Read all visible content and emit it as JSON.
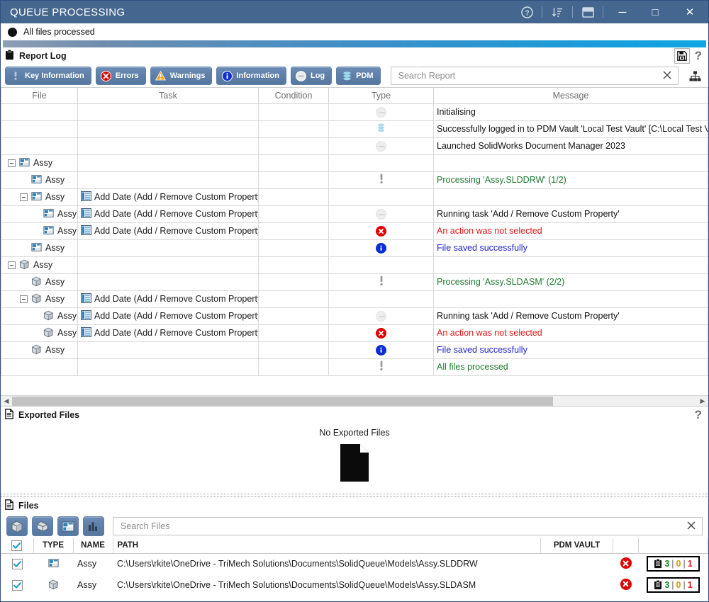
{
  "window": {
    "title": "QUEUE PROCESSING",
    "titlebar_icons": [
      "help-icon",
      "sort-descending-icon",
      "window-layout-icon"
    ],
    "controls": {
      "minimize": "─",
      "maximize": "□",
      "close": "✕"
    }
  },
  "status": {
    "text": "All files processed",
    "progress_percent": 100
  },
  "report_log": {
    "title": "Report Log",
    "save_icon": "floppy-disk-icon",
    "help_icon": "question-mark-icon",
    "filters": [
      {
        "label": "Key Information",
        "icon": "exclamation-icon"
      },
      {
        "label": "Errors",
        "icon": "error-circle-icon"
      },
      {
        "label": "Warnings",
        "icon": "warning-triangle-icon"
      },
      {
        "label": "Information",
        "icon": "info-circle-icon"
      },
      {
        "label": "Log",
        "icon": "log-circle-icon"
      },
      {
        "label": "PDM",
        "icon": "database-icon"
      }
    ],
    "search": {
      "placeholder": "Search Report",
      "value": "",
      "clear_icon": "close-x-icon"
    },
    "tree_view_icon": "hierarchy-icon",
    "columns": [
      "File",
      "Task",
      "Condition",
      "Type",
      "Message"
    ],
    "rows": [
      {
        "indent": 0,
        "expander": false,
        "file": "",
        "file_icon": "",
        "task": "",
        "condition": "",
        "type": "log",
        "message": "Initialising",
        "color": "black"
      },
      {
        "indent": 0,
        "expander": false,
        "file": "",
        "file_icon": "",
        "task": "",
        "condition": "",
        "type": "pdm",
        "message": "Successfully logged in to PDM Vault 'Local Test Vault' [C:\\Local Test Vaul",
        "color": "black"
      },
      {
        "indent": 0,
        "expander": false,
        "file": "",
        "file_icon": "",
        "task": "",
        "condition": "",
        "type": "log",
        "message": "Launched SolidWorks Document Manager 2023",
        "color": "black"
      },
      {
        "indent": 0,
        "expander": true,
        "file": "Assy",
        "file_icon": "drawing-icon",
        "task": "",
        "condition": "",
        "type": "",
        "message": "",
        "color": "black"
      },
      {
        "indent": 1,
        "expander": false,
        "file": "Assy",
        "file_icon": "drawing-icon",
        "task": "",
        "condition": "",
        "type": "key",
        "message": "Processing 'Assy.SLDDRW' (1/2)",
        "color": "green"
      },
      {
        "indent": 1,
        "expander": true,
        "file": "Assy",
        "file_icon": "drawing-icon",
        "task": "Add Date (Add / Remove Custom Property)",
        "task_icon": "property-list-icon",
        "condition": "",
        "type": "",
        "message": "",
        "color": "black"
      },
      {
        "indent": 2,
        "expander": false,
        "file": "Assy",
        "file_icon": "drawing-icon",
        "task": "Add Date (Add / Remove Custom Property)",
        "task_icon": "property-list-icon",
        "condition": "",
        "type": "log",
        "message": "Running task 'Add / Remove Custom Property'",
        "color": "black"
      },
      {
        "indent": 2,
        "expander": false,
        "file": "Assy",
        "file_icon": "drawing-icon",
        "task": "Add Date (Add / Remove Custom Property)",
        "task_icon": "property-list-icon",
        "condition": "",
        "type": "error",
        "message": "An action was not selected",
        "color": "red"
      },
      {
        "indent": 1,
        "expander": false,
        "file": "Assy",
        "file_icon": "drawing-icon",
        "task": "",
        "condition": "",
        "type": "info",
        "message": "File saved successfully",
        "color": "blue"
      },
      {
        "indent": 0,
        "expander": true,
        "file": "Assy",
        "file_icon": "assembly-icon",
        "task": "",
        "condition": "",
        "type": "",
        "message": "",
        "color": "black"
      },
      {
        "indent": 1,
        "expander": false,
        "file": "Assy",
        "file_icon": "assembly-icon",
        "task": "",
        "condition": "",
        "type": "key",
        "message": "Processing 'Assy.SLDASM' (2/2)",
        "color": "green"
      },
      {
        "indent": 1,
        "expander": true,
        "file": "Assy",
        "file_icon": "assembly-icon",
        "task": "Add Date (Add / Remove Custom Property)",
        "task_icon": "property-list-icon",
        "condition": "",
        "type": "",
        "message": "",
        "color": "black"
      },
      {
        "indent": 2,
        "expander": false,
        "file": "Assy",
        "file_icon": "assembly-icon",
        "task": "Add Date (Add / Remove Custom Property)",
        "task_icon": "property-list-icon",
        "condition": "",
        "type": "log",
        "message": "Running task 'Add / Remove Custom Property'",
        "color": "black"
      },
      {
        "indent": 2,
        "expander": false,
        "file": "Assy",
        "file_icon": "assembly-icon",
        "task": "Add Date (Add / Remove Custom Property)",
        "task_icon": "property-list-icon",
        "condition": "",
        "type": "error",
        "message": "An action was not selected",
        "color": "red"
      },
      {
        "indent": 1,
        "expander": false,
        "file": "Assy",
        "file_icon": "assembly-icon",
        "task": "",
        "condition": "",
        "type": "info",
        "message": "File saved successfully",
        "color": "blue"
      },
      {
        "indent": 0,
        "expander": false,
        "file": "",
        "file_icon": "",
        "task": "",
        "condition": "",
        "type": "key",
        "message": "All files processed",
        "color": "green"
      }
    ]
  },
  "exported_files": {
    "title": "Exported Files",
    "icon": "document-icon",
    "help_icon": "question-mark-icon",
    "empty_message": "No Exported Files"
  },
  "files": {
    "title": "Files",
    "icon": "document-icon",
    "toolbar_buttons": [
      {
        "icon": "assembly-icon",
        "name": "filter-assemblies"
      },
      {
        "icon": "part-icon",
        "name": "filter-parts"
      },
      {
        "icon": "drawing-icon",
        "name": "filter-drawings"
      },
      {
        "icon": "chart-icon",
        "name": "filter-statistics"
      }
    ],
    "search": {
      "placeholder": "Search Files",
      "value": "",
      "clear_icon": "close-x-icon"
    },
    "columns": [
      "",
      "TYPE",
      "NAME",
      "PATH",
      "PDM VAULT",
      "",
      ""
    ],
    "rows": [
      {
        "checked": true,
        "type_icon": "drawing-icon",
        "name": "Assy",
        "path": "C:\\Users\\rkite\\OneDrive - TriMech Solutions\\Documents\\SolidQueue\\Models\\Assy.SLDDRW",
        "pdm_vault": "",
        "status_icon": "error-circle-icon",
        "counts": {
          "green": "3",
          "orange": "0",
          "red": "1",
          "separator": "|",
          "icon": "clipboard-icon"
        }
      },
      {
        "checked": true,
        "type_icon": "assembly-icon",
        "name": "Assy",
        "path": "C:\\Users\\rkite\\OneDrive - TriMech Solutions\\Documents\\SolidQueue\\Models\\Assy.SLDASM",
        "pdm_vault": "",
        "status_icon": "error-circle-icon",
        "counts": {
          "green": "3",
          "orange": "0",
          "red": "1",
          "separator": "|",
          "icon": "clipboard-icon"
        }
      }
    ],
    "select_all_checked": true
  },
  "colors": {
    "titlebar": "#44668f",
    "button": "#5d7fa9",
    "error": "#e10000",
    "info": "#0b2fd0",
    "success": "#1f7a30",
    "warning": "#f5a623"
  }
}
